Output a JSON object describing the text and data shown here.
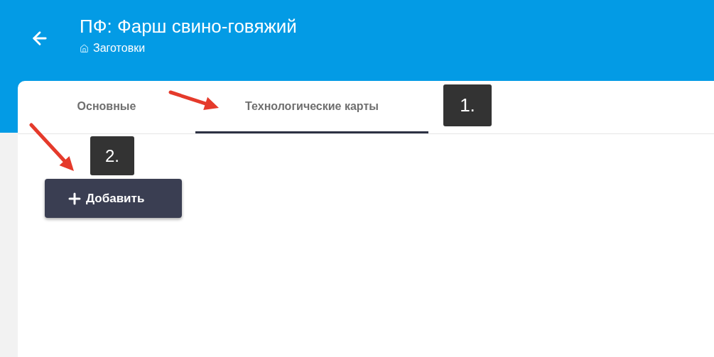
{
  "header": {
    "title": "ПФ: Фарш свино-говяжий",
    "breadcrumb": "Заготовки"
  },
  "tabs": [
    {
      "label": "Основные",
      "selected": false
    },
    {
      "label": "Технологические карты",
      "selected": true
    }
  ],
  "add_button": {
    "label": "Добавить"
  },
  "callouts": [
    {
      "label": "1."
    },
    {
      "label": "2."
    }
  ]
}
